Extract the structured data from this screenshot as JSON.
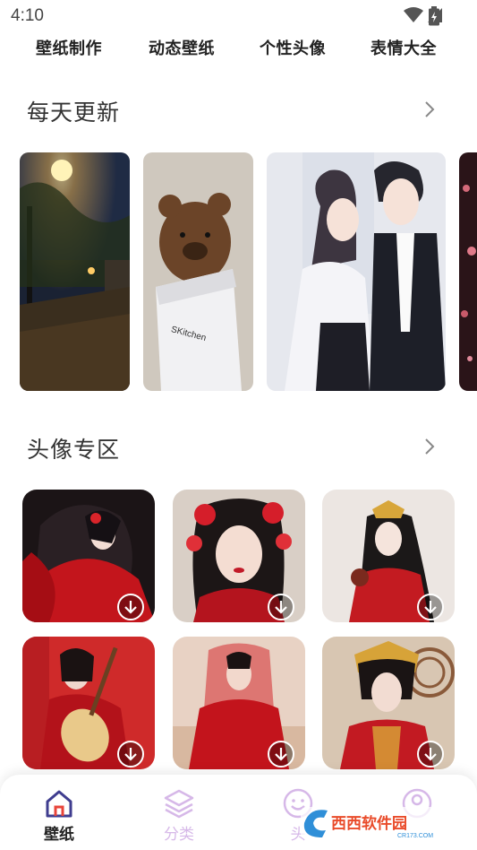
{
  "status": {
    "time": "4:10"
  },
  "top_tabs": [
    {
      "label": "壁纸制作"
    },
    {
      "label": "动态壁纸"
    },
    {
      "label": "个性头像"
    },
    {
      "label": "表情大全"
    }
  ],
  "sections": {
    "daily": {
      "title": "每天更新"
    },
    "avatars": {
      "title": "头像专区"
    }
  },
  "daily_cards": [
    {
      "subject": "night street with streetlight"
    },
    {
      "subject": "teddy bear in paper bag",
      "bag_text": "SKitchen"
    },
    {
      "subject": "anime couple illustration"
    },
    {
      "subject": "partial red floral"
    }
  ],
  "avatar_cards": [
    {
      "subject": "anime girl in red"
    },
    {
      "subject": "girl with red flower headdress"
    },
    {
      "subject": "illustrated girl with golden crown"
    },
    {
      "subject": "woman with pipa"
    },
    {
      "subject": "woman in red veil"
    },
    {
      "subject": "woman with golden headdress"
    }
  ],
  "bottom_nav": [
    {
      "label": "壁纸",
      "icon": "home-icon",
      "active": true
    },
    {
      "label": "分类",
      "icon": "layers-icon",
      "active": false
    },
    {
      "label": "头",
      "icon": "smile-icon",
      "active": false
    },
    {
      "label": "",
      "icon": "profile-icon",
      "active": false
    }
  ],
  "watermark": {
    "brand": "西西软件园",
    "site": "CR173.COM"
  },
  "colors": {
    "accent": "#3f3d8f",
    "accent_red": "#e8443a",
    "inactive": "#d6b8e8"
  }
}
